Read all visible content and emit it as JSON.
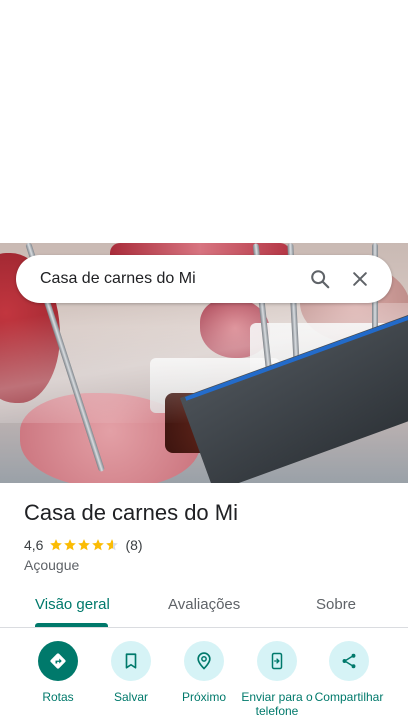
{
  "search": {
    "query": "Casa de carnes do Mi"
  },
  "place": {
    "name": "Casa de carnes do Mi",
    "rating": "4,6",
    "rating_value": 4.6,
    "reviews": "(8)",
    "category": "Açougue"
  },
  "tabs": [
    {
      "label": "Visão geral",
      "active": true
    },
    {
      "label": "Avaliações",
      "active": false
    },
    {
      "label": "Sobre",
      "active": false
    }
  ],
  "actions": [
    {
      "label": "Rotas",
      "icon": "directions-icon"
    },
    {
      "label": "Salvar",
      "icon": "bookmark-icon"
    },
    {
      "label": "Próximo",
      "icon": "nearby-icon"
    },
    {
      "label": "Enviar para o telefone",
      "icon": "send-to-phone-icon"
    },
    {
      "label": "Compartilhar",
      "icon": "share-icon"
    }
  ],
  "colors": {
    "accent": "#00796b",
    "action_bg": "#d6f3f6",
    "star": "#fbbc04"
  }
}
